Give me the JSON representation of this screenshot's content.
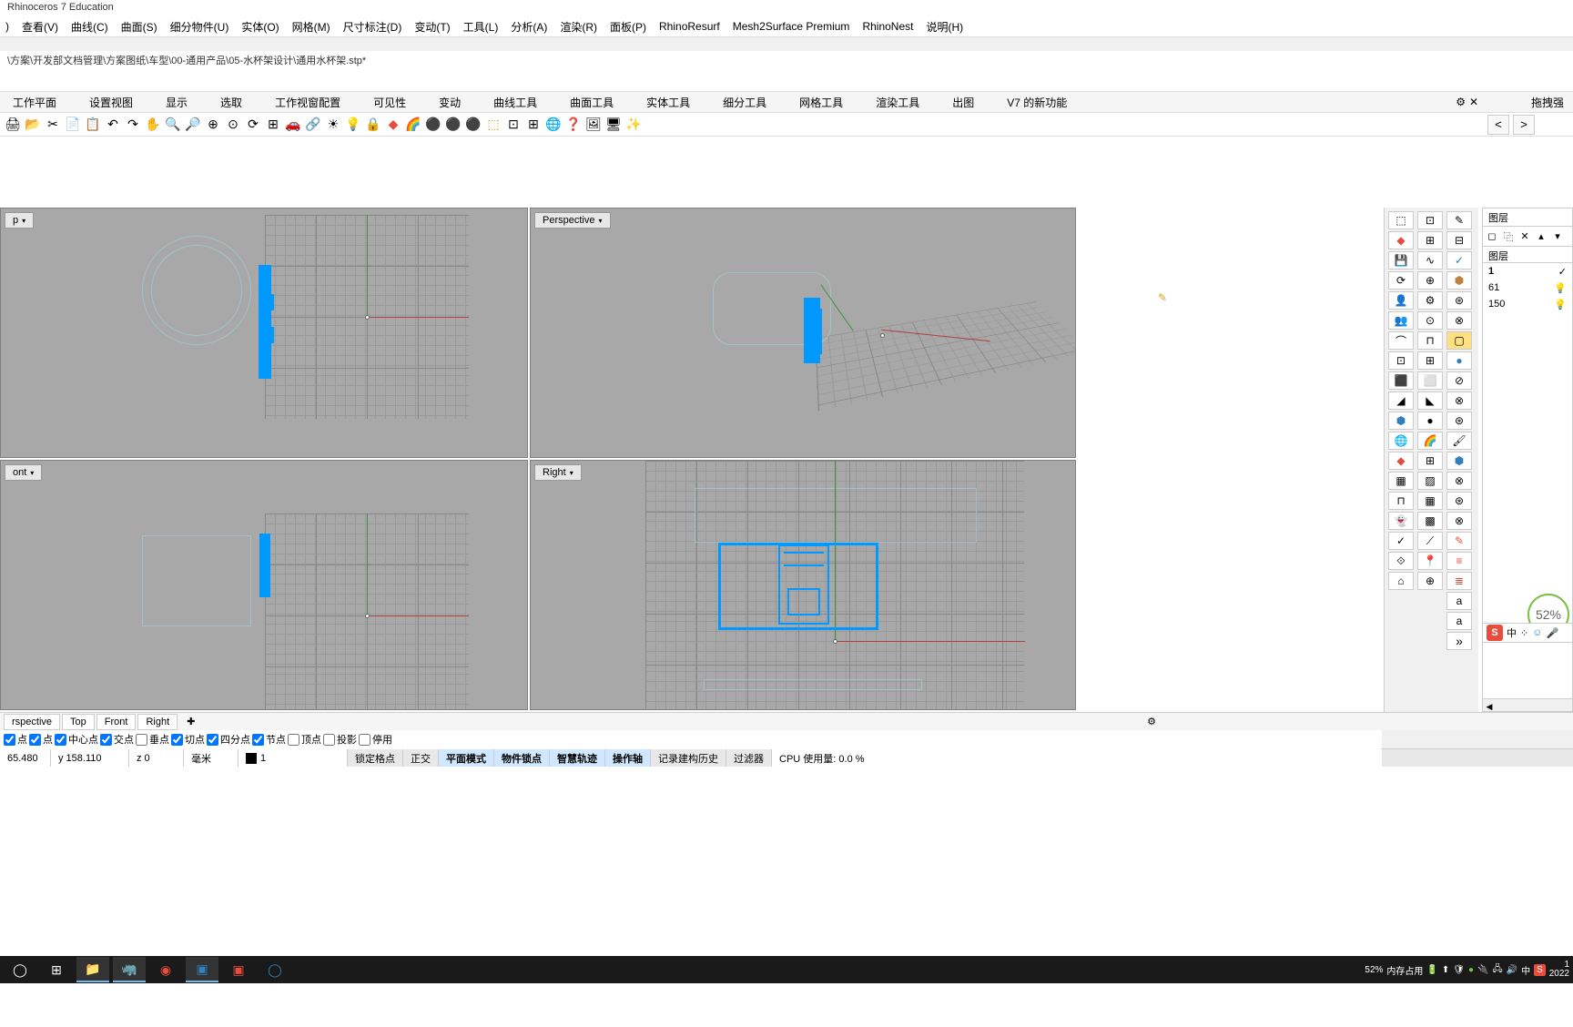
{
  "app_title": "Rhinoceros 7 Education",
  "menu": [
    "查看(V)",
    "曲线(C)",
    "曲面(S)",
    "细分物件(U)",
    "实体(O)",
    "网格(M)",
    "尺寸标注(D)",
    "变动(T)",
    "工具(L)",
    "分析(A)",
    "渲染(R)",
    "面板(P)",
    "RhinoResurf",
    "Mesh2Surface Premium",
    "RhinoNest",
    "说明(H)"
  ],
  "file_path": "\\方案\\开发部文档管理\\方案图纸\\车型\\00-通用产品\\05-水杯架设计\\通用水杯架.stp*",
  "tabs": [
    "工作平面",
    "设置视图",
    "显示",
    "选取",
    "工作视窗配置",
    "可见性",
    "变动",
    "曲线工具",
    "曲面工具",
    "实体工具",
    "细分工具",
    "网格工具",
    "渲染工具",
    "出图",
    "V7 的新功能"
  ],
  "drag_label": "拖拽强",
  "viewports": {
    "top": "p",
    "persp": "Perspective",
    "front": "ont",
    "right": "Right"
  },
  "layers_panel": {
    "title": "图层",
    "subhead": "图层",
    "rows": [
      {
        "name": "1",
        "active": true,
        "check": true
      },
      {
        "name": "61",
        "active": false,
        "check": false
      },
      {
        "name": "150",
        "active": false,
        "check": false
      }
    ]
  },
  "bottom_tabs": [
    "rspective",
    "Top",
    "Front",
    "Right"
  ],
  "osnap": [
    {
      "label": "点",
      "checked": true
    },
    {
      "label": "点",
      "checked": true
    },
    {
      "label": "中心点",
      "checked": true
    },
    {
      "label": "交点",
      "checked": true
    },
    {
      "label": "垂点",
      "checked": false
    },
    {
      "label": "切点",
      "checked": true
    },
    {
      "label": "四分点",
      "checked": true
    },
    {
      "label": "节点",
      "checked": true
    },
    {
      "label": "顶点",
      "checked": false
    },
    {
      "label": "投影",
      "checked": false
    },
    {
      "label": "停用",
      "checked": false
    }
  ],
  "status": {
    "x": "65.480",
    "y": "y 158.110",
    "z": "z 0",
    "unit": "毫米",
    "layer": "1",
    "modes": [
      "锁定格点",
      "正交",
      "平面模式",
      "物件锁点",
      "智慧轨迹",
      "操作轴",
      "记录建构历史",
      "过滤器"
    ],
    "cpu": "CPU 使用量: 0.0 %"
  },
  "taskbar_tray": {
    "percent": "52%",
    "mem": "内存占用",
    "year": "2022"
  },
  "cpu_widget": "52%",
  "ime": "中"
}
